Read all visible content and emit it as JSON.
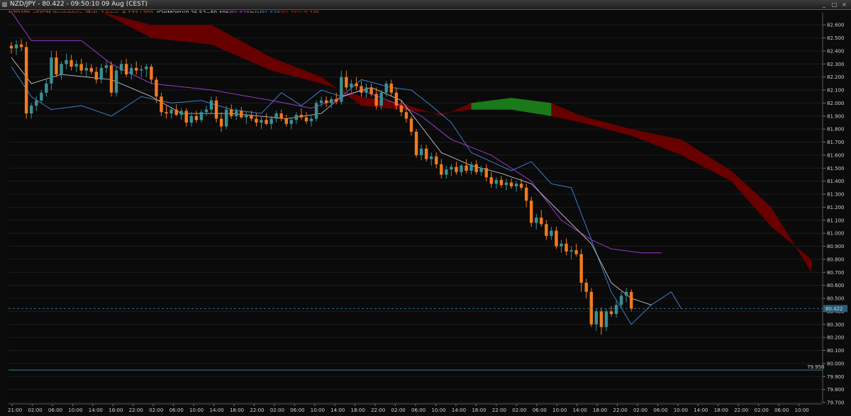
{
  "window": {
    "title": "NZD/JPY - 80.422 - 09:50:10  09 Aug (CEST)",
    "buttons": [
      "_",
      "□",
      "×"
    ]
  },
  "info_line": [
    {
      "text": "NZD/JPY <FXCM (tradable)> (Bid), 1 hour, # 133 / 300, ",
      "color": "#d8622a"
    },
    {
      "text": "ICHIMOKU(9,26,52=80.496/",
      "color": "#cfcfcf"
    },
    {
      "text": "80.828",
      "color": "#b04bd8"
    },
    {
      "text": "/n/a/",
      "color": "#cfcfcf"
    },
    {
      "text": "81.538",
      "color": "#3a7fd0"
    },
    {
      "text": "/81.782/",
      "color": "#c02020"
    },
    {
      "text": "-0.245",
      "color": "#d04040"
    }
  ],
  "chart_data": {
    "type": "candlestick",
    "symbol": "NZD/JPY",
    "timeframe": "1 hour",
    "ylim": [
      79.7,
      82.65
    ],
    "y_ticks": [
      "82.600",
      "82.500",
      "82.400",
      "82.300",
      "82.200",
      "82.100",
      "82.000",
      "81.900",
      "81.800",
      "81.700",
      "81.600",
      "81.500",
      "81.400",
      "81.300",
      "81.200",
      "81.100",
      "81.000",
      "80.900",
      "80.800",
      "80.700",
      "80.600",
      "80.500",
      "80.400",
      "80.300",
      "80.200",
      "80.100",
      "80.000",
      "79.900",
      "79.800",
      "79.700"
    ],
    "x_ticks": [
      "21:00",
      "02:00",
      "06:00",
      "10:00",
      "14:00",
      "18:00",
      "22:00",
      "02:00",
      "06:00",
      "10:00",
      "14:00",
      "18:00",
      "22:00",
      "02:00",
      "06:00",
      "10:00",
      "14:00",
      "18:00",
      "22:00",
      "02:00",
      "06:00",
      "10:00",
      "14:00",
      "18:00",
      "22:00",
      "02:00",
      "06:00",
      "10:00",
      "14:00",
      "18:00",
      "22:00",
      "02:00",
      "06:00",
      "10:00",
      "14:00",
      "18:00",
      "22:00",
      "02:00",
      "06:00",
      "10:00"
    ],
    "current_price": {
      "label": "80.422",
      "value": 80.422
    },
    "level_line": {
      "label": "79.950",
      "value": 79.95
    },
    "colors": {
      "bull": "#3a9090",
      "bear": "#f07a20",
      "kumo_bear": "#6e0000",
      "kumo_bull": "#1a7a1a",
      "tenkan": "#d8d8d8",
      "kijun": "#9a3ac8",
      "chikou": "#3a7fd0",
      "grid": "#1c1c1c",
      "axis_text": "#cfcfcf"
    },
    "candles": [
      [
        82.44,
        82.47,
        82.38,
        82.42
      ],
      [
        82.42,
        82.48,
        82.37,
        82.45
      ],
      [
        82.45,
        82.49,
        82.4,
        82.43
      ],
      [
        82.43,
        82.47,
        81.88,
        81.92
      ],
      [
        81.92,
        82.0,
        81.88,
        81.98
      ],
      [
        81.98,
        82.05,
        81.94,
        82.02
      ],
      [
        82.02,
        82.1,
        82.0,
        82.08
      ],
      [
        82.08,
        82.18,
        82.05,
        82.15
      ],
      [
        82.15,
        82.4,
        82.1,
        82.35
      ],
      [
        82.35,
        82.4,
        82.2,
        82.22
      ],
      [
        82.22,
        82.32,
        82.18,
        82.3
      ],
      [
        82.3,
        82.38,
        82.26,
        82.33
      ],
      [
        82.33,
        82.37,
        82.25,
        82.28
      ],
      [
        82.28,
        82.33,
        82.24,
        82.3
      ],
      [
        82.3,
        82.34,
        82.22,
        82.25
      ],
      [
        82.25,
        82.31,
        82.2,
        82.27
      ],
      [
        82.27,
        82.3,
        82.22,
        82.24
      ],
      [
        82.24,
        82.28,
        82.15,
        82.18
      ],
      [
        82.18,
        82.3,
        82.15,
        82.27
      ],
      [
        82.27,
        82.33,
        82.23,
        82.29
      ],
      [
        82.29,
        82.32,
        82.05,
        82.08
      ],
      [
        82.08,
        82.28,
        82.05,
        82.25
      ],
      [
        82.25,
        82.33,
        82.22,
        82.3
      ],
      [
        82.3,
        82.34,
        82.2,
        82.22
      ],
      [
        82.22,
        82.3,
        82.18,
        82.27
      ],
      [
        82.27,
        82.32,
        82.22,
        82.25
      ],
      [
        82.25,
        82.29,
        82.2,
        82.26
      ],
      [
        82.26,
        82.3,
        82.2,
        82.28
      ],
      [
        82.28,
        82.3,
        82.15,
        82.18
      ],
      [
        82.18,
        82.2,
        82.0,
        82.05
      ],
      [
        82.05,
        82.08,
        81.9,
        81.93
      ],
      [
        81.93,
        81.98,
        81.88,
        81.92
      ],
      [
        81.92,
        81.97,
        81.88,
        81.95
      ],
      [
        81.95,
        81.99,
        81.9,
        81.91
      ],
      [
        81.91,
        81.96,
        81.87,
        81.94
      ],
      [
        81.94,
        81.96,
        81.82,
        81.85
      ],
      [
        81.85,
        81.93,
        81.82,
        81.9
      ],
      [
        81.9,
        81.94,
        81.85,
        81.87
      ],
      [
        81.87,
        81.95,
        81.85,
        81.93
      ],
      [
        81.93,
        81.98,
        81.9,
        81.95
      ],
      [
        81.95,
        82.05,
        81.92,
        82.02
      ],
      [
        82.02,
        82.05,
        81.85,
        81.88
      ],
      [
        81.88,
        81.93,
        81.78,
        81.82
      ],
      [
        81.82,
        81.98,
        81.8,
        81.95
      ],
      [
        81.95,
        81.99,
        81.88,
        81.9
      ],
      [
        81.9,
        81.96,
        81.87,
        81.94
      ],
      [
        81.94,
        81.97,
        81.88,
        81.89
      ],
      [
        81.89,
        81.93,
        81.84,
        81.91
      ],
      [
        81.91,
        81.94,
        81.86,
        81.88
      ],
      [
        81.88,
        81.92,
        81.82,
        81.85
      ],
      [
        81.85,
        81.9,
        81.8,
        81.87
      ],
      [
        81.87,
        81.92,
        81.83,
        81.84
      ],
      [
        81.84,
        81.9,
        81.8,
        81.88
      ],
      [
        81.88,
        81.94,
        81.85,
        81.92
      ],
      [
        81.92,
        81.95,
        81.86,
        81.88
      ],
      [
        81.88,
        81.91,
        81.82,
        81.84
      ],
      [
        81.84,
        81.89,
        81.8,
        81.87
      ],
      [
        81.87,
        81.93,
        81.84,
        81.91
      ],
      [
        81.91,
        81.96,
        81.87,
        81.89
      ],
      [
        81.89,
        81.93,
        81.84,
        81.86
      ],
      [
        81.86,
        81.9,
        81.82,
        81.88
      ],
      [
        81.88,
        82.02,
        81.86,
        82.0
      ],
      [
        82.0,
        82.05,
        81.97,
        82.02
      ],
      [
        82.02,
        82.05,
        81.97,
        82.0
      ],
      [
        82.0,
        82.05,
        81.96,
        82.03
      ],
      [
        82.03,
        82.08,
        81.99,
        82.01
      ],
      [
        82.01,
        82.25,
        81.99,
        82.2
      ],
      [
        82.2,
        82.25,
        82.1,
        82.12
      ],
      [
        82.12,
        82.18,
        82.08,
        82.15
      ],
      [
        82.15,
        82.2,
        82.1,
        82.13
      ],
      [
        82.13,
        82.17,
        82.05,
        82.08
      ],
      [
        82.08,
        82.15,
        82.04,
        82.12
      ],
      [
        82.12,
        82.15,
        82.05,
        82.07
      ],
      [
        82.07,
        82.12,
        81.95,
        81.98
      ],
      [
        81.98,
        82.1,
        81.95,
        82.08
      ],
      [
        82.08,
        82.17,
        82.05,
        82.15
      ],
      [
        82.15,
        82.18,
        82.05,
        82.08
      ],
      [
        82.08,
        82.12,
        81.95,
        81.98
      ],
      [
        81.98,
        82.02,
        81.9,
        81.93
      ],
      [
        81.93,
        81.96,
        81.85,
        81.88
      ],
      [
        81.88,
        81.9,
        81.75,
        81.78
      ],
      [
        81.78,
        81.8,
        81.58,
        81.6
      ],
      [
        81.6,
        81.68,
        81.56,
        81.65
      ],
      [
        81.65,
        81.68,
        81.55,
        81.57
      ],
      [
        81.57,
        81.62,
        81.52,
        81.59
      ],
      [
        81.59,
        81.62,
        81.5,
        81.53
      ],
      [
        81.53,
        81.57,
        81.42,
        81.45
      ],
      [
        81.45,
        81.52,
        81.42,
        81.49
      ],
      [
        81.49,
        81.53,
        81.44,
        81.51
      ],
      [
        81.51,
        81.55,
        81.45,
        81.47
      ],
      [
        81.47,
        81.53,
        81.44,
        81.52
      ],
      [
        81.52,
        81.57,
        81.46,
        81.48
      ],
      [
        81.48,
        81.55,
        81.45,
        81.53
      ],
      [
        81.53,
        81.56,
        81.45,
        81.47
      ],
      [
        81.47,
        81.52,
        81.44,
        81.5
      ],
      [
        81.5,
        81.53,
        81.4,
        81.43
      ],
      [
        81.43,
        81.47,
        81.35,
        81.38
      ],
      [
        81.38,
        81.43,
        81.34,
        81.41
      ],
      [
        81.41,
        81.44,
        81.35,
        81.37
      ],
      [
        81.37,
        81.42,
        81.33,
        81.39
      ],
      [
        81.39,
        81.42,
        81.34,
        81.36
      ],
      [
        81.36,
        81.4,
        81.32,
        81.38
      ],
      [
        81.38,
        81.42,
        81.33,
        81.35
      ],
      [
        81.35,
        81.38,
        81.2,
        81.25
      ],
      [
        81.25,
        81.28,
        81.05,
        81.08
      ],
      [
        81.08,
        81.15,
        81.03,
        81.12
      ],
      [
        81.12,
        81.18,
        81.05,
        81.07
      ],
      [
        81.07,
        81.1,
        80.95,
        80.98
      ],
      [
        80.98,
        81.05,
        80.95,
        81.02
      ],
      [
        81.02,
        81.05,
        80.88,
        80.9
      ],
      [
        80.9,
        80.95,
        80.85,
        80.92
      ],
      [
        80.92,
        80.96,
        80.83,
        80.86
      ],
      [
        80.86,
        80.9,
        80.8,
        80.87
      ],
      [
        80.87,
        80.92,
        80.82,
        80.84
      ],
      [
        80.84,
        80.88,
        80.55,
        80.62
      ],
      [
        80.62,
        80.65,
        80.5,
        80.55
      ],
      [
        80.55,
        80.58,
        80.28,
        80.3
      ],
      [
        80.3,
        80.42,
        80.25,
        80.4
      ],
      [
        80.4,
        80.43,
        80.22,
        80.28
      ],
      [
        80.28,
        80.42,
        80.25,
        80.4
      ],
      [
        80.4,
        80.44,
        80.36,
        80.38
      ],
      [
        80.38,
        80.48,
        80.35,
        80.45
      ],
      [
        80.45,
        80.55,
        80.42,
        80.52
      ],
      [
        80.52,
        80.58,
        80.47,
        80.55
      ],
      [
        80.55,
        80.57,
        80.4,
        80.42
      ]
    ],
    "tenkan": [
      [
        0,
        82.35
      ],
      [
        4,
        82.15
      ],
      [
        10,
        82.22
      ],
      [
        20,
        82.18
      ],
      [
        28,
        82.05
      ],
      [
        34,
        81.92
      ],
      [
        44,
        81.92
      ],
      [
        55,
        81.88
      ],
      [
        62,
        81.92
      ],
      [
        66,
        82.05
      ],
      [
        72,
        82.12
      ],
      [
        78,
        82.02
      ],
      [
        82,
        81.82
      ],
      [
        86,
        81.62
      ],
      [
        92,
        81.52
      ],
      [
        98,
        81.46
      ],
      [
        104,
        81.38
      ],
      [
        110,
        81.15
      ],
      [
        116,
        80.92
      ],
      [
        120,
        80.62
      ],
      [
        124,
        80.5
      ],
      [
        128,
        80.45
      ]
    ],
    "kijun": [
      [
        0,
        82.7
      ],
      [
        4,
        82.48
      ],
      [
        14,
        82.48
      ],
      [
        20,
        82.3
      ],
      [
        28,
        82.15
      ],
      [
        40,
        82.1
      ],
      [
        52,
        82.02
      ],
      [
        60,
        81.96
      ],
      [
        70,
        82.1
      ],
      [
        78,
        81.98
      ],
      [
        82,
        81.9
      ],
      [
        88,
        81.72
      ],
      [
        96,
        81.6
      ],
      [
        104,
        81.4
      ],
      [
        110,
        81.1
      ],
      [
        116,
        80.95
      ],
      [
        120,
        80.88
      ],
      [
        126,
        80.85
      ],
      [
        130,
        80.85
      ]
    ],
    "chikou": [
      [
        0,
        82.28
      ],
      [
        4,
        82.05
      ],
      [
        8,
        81.95
      ],
      [
        14,
        81.98
      ],
      [
        20,
        81.9
      ],
      [
        26,
        82.05
      ],
      [
        32,
        82.0
      ],
      [
        38,
        82.02
      ],
      [
        44,
        81.95
      ],
      [
        50,
        81.92
      ],
      [
        54,
        82.08
      ],
      [
        58,
        81.98
      ],
      [
        62,
        82.1
      ],
      [
        66,
        82.05
      ],
      [
        70,
        82.18
      ],
      [
        76,
        82.12
      ],
      [
        80,
        82.1
      ],
      [
        84,
        81.98
      ],
      [
        88,
        81.85
      ],
      [
        92,
        81.62
      ],
      [
        96,
        81.55
      ],
      [
        100,
        81.48
      ],
      [
        104,
        81.55
      ],
      [
        108,
        81.38
      ],
      [
        112,
        81.35
      ],
      [
        116,
        80.95
      ],
      [
        120,
        80.55
      ],
      [
        124,
        80.3
      ],
      [
        128,
        80.45
      ],
      [
        132,
        80.55
      ],
      [
        134,
        80.42
      ]
    ],
    "senkou_a": [
      [
        18,
        82.7
      ],
      [
        28,
        82.5
      ],
      [
        40,
        82.45
      ],
      [
        52,
        82.25
      ],
      [
        62,
        82.15
      ],
      [
        70,
        82.05
      ],
      [
        78,
        82.0
      ],
      [
        86,
        81.9
      ],
      [
        92,
        82.0
      ],
      [
        100,
        82.04
      ],
      [
        108,
        82.0
      ],
      [
        114,
        81.9
      ],
      [
        124,
        81.8
      ],
      [
        134,
        81.72
      ],
      [
        144,
        81.48
      ],
      [
        152,
        81.2
      ],
      [
        160,
        80.7
      ]
    ],
    "senkou_b": [
      [
        18,
        82.7
      ],
      [
        28,
        82.6
      ],
      [
        40,
        82.6
      ],
      [
        52,
        82.35
      ],
      [
        62,
        82.2
      ],
      [
        70,
        81.98
      ],
      [
        78,
        81.95
      ],
      [
        86,
        81.92
      ],
      [
        92,
        81.95
      ],
      [
        100,
        81.95
      ],
      [
        108,
        81.9
      ],
      [
        114,
        81.85
      ],
      [
        124,
        81.75
      ],
      [
        134,
        81.6
      ],
      [
        144,
        81.4
      ],
      [
        152,
        81.05
      ],
      [
        160,
        80.8
      ]
    ]
  }
}
